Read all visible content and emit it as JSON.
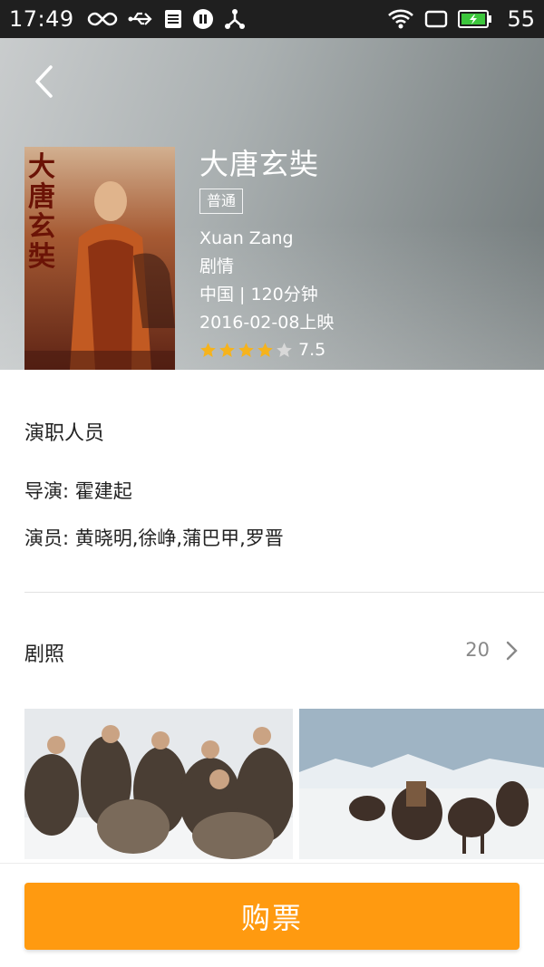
{
  "status_bar": {
    "time": "17:49",
    "battery": "55",
    "icons": [
      "infinity-icon",
      "usb-icon",
      "notes-icon",
      "pause-icon",
      "share-icon",
      "wifi-icon",
      "screen-icon",
      "battery-charging-icon"
    ]
  },
  "header": {
    "back_icon": "chevron-left-icon"
  },
  "movie": {
    "title": "大唐玄奘",
    "badge": "普通",
    "english_title": "Xuan Zang",
    "genre": "剧情",
    "country_duration": "中国 | 120分钟",
    "release": "2016-02-08上映",
    "rating": "7.5",
    "stars_filled": 4,
    "stars_total": 5,
    "poster_text": "大唐玄奘"
  },
  "cast": {
    "section_title": "演职人员",
    "director": "导演: 霍建起",
    "actors": "演员: 黄晓明,徐峥,蒲巴甲,罗晋"
  },
  "stills": {
    "section_title": "剧照",
    "count": "20"
  },
  "actions": {
    "buy_label": "购票"
  },
  "colors": {
    "accent": "#ff9a10",
    "star": "#f6b31c",
    "star_empty": "#d8d8d8"
  }
}
